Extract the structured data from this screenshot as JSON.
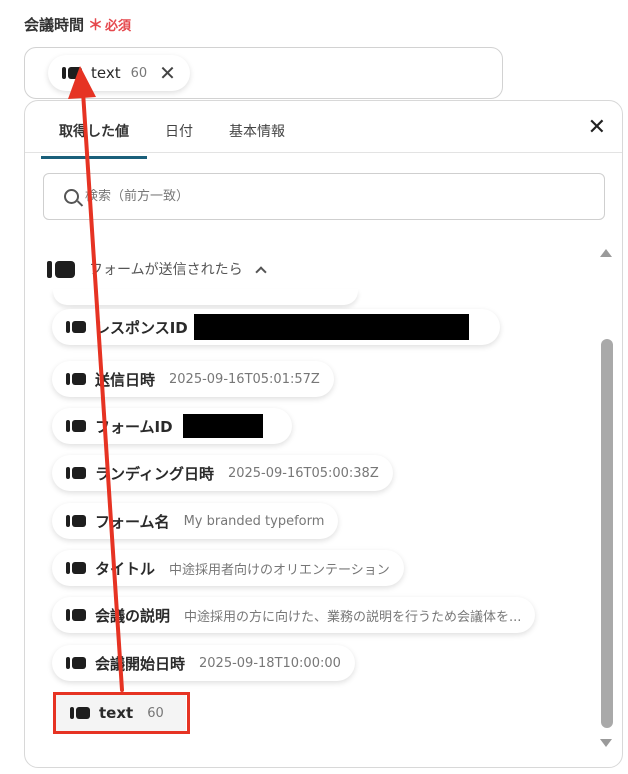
{
  "field": {
    "label": "会議時間",
    "required_mark": "＊",
    "required_text": "必須",
    "selected_chip": {
      "name": "text",
      "value": "60",
      "remove_icon": "close-icon"
    }
  },
  "panel": {
    "tabs": [
      {
        "label": "取得した値",
        "active": true
      },
      {
        "label": "日付",
        "active": false
      },
      {
        "label": "基本情報",
        "active": false
      }
    ],
    "close_icon": "close-icon",
    "search": {
      "placeholder": "検索（前方一致）",
      "value": "",
      "icon": "search-icon"
    },
    "group": {
      "title": "フォームが送信されたら",
      "icon": "variable-icon",
      "toggle_icon": "chevron-up-icon"
    },
    "items": [
      {
        "name": "レスポンスID",
        "value": "",
        "redacted": true
      },
      {
        "name": "送信日時",
        "value": "2025-09-16T05:01:57Z"
      },
      {
        "name": "フォームID",
        "value": "",
        "redacted": true
      },
      {
        "name": "ランディング日時",
        "value": "2025-09-16T05:00:38Z"
      },
      {
        "name": "フォーム名",
        "value": "My branded typeform"
      },
      {
        "name": "タイトル",
        "value": "中途採用者向けのオリエンテーション"
      },
      {
        "name": "会議の説明",
        "value": "中途採用の方に向けた、業務の説明を行うため会議体を..."
      },
      {
        "name": "会議開始日時",
        "value": "2025-09-18T10:00:00"
      },
      {
        "name": "text",
        "value": "60"
      }
    ]
  },
  "annotation": {
    "color": "#e63323"
  },
  "colors": {
    "tab_underline": "#1a5f7a",
    "required": "#e5484d"
  }
}
